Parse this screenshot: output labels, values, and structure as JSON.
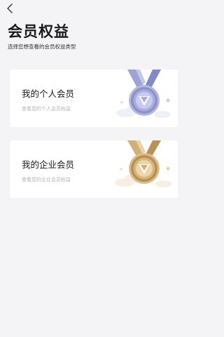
{
  "nav": {
    "back_icon": "chevron-left-icon"
  },
  "header": {
    "title": "会员权益",
    "subtitle": "选择您想查看的会员权益类型"
  },
  "cards": [
    {
      "title": "我的个人会员",
      "description": "查看您的个人会员权益",
      "medal_icon": "silver-medal-icon",
      "medal_color": "#8f95c8"
    },
    {
      "title": "我的企业会员",
      "description": "查看您的企业会员权益",
      "medal_icon": "gold-medal-icon",
      "medal_color": "#c9a46c"
    }
  ],
  "colors": {
    "background": "#f4f4f6",
    "card": "#ffffff",
    "title": "#1a1a1a",
    "muted": "#b3b3b8"
  }
}
